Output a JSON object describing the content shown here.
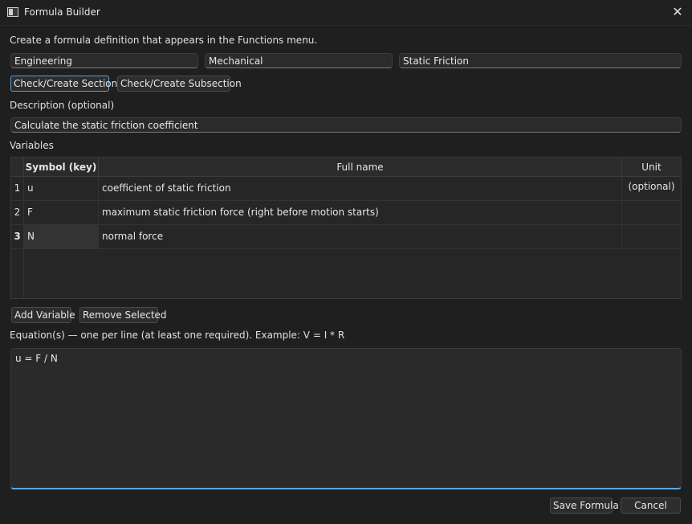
{
  "window": {
    "title": "Formula Builder",
    "close_glyph": "✕"
  },
  "intro": "Create a formula definition that appears in the Functions menu.",
  "category": {
    "section": "Engineering",
    "subsection": "Mechanical",
    "name": "Static Friction"
  },
  "buttons": {
    "check_section": "Check/Create Section",
    "check_subsection": "Check/Create Subsection",
    "add_variable": "Add Variable",
    "remove_selected": "Remove Selected",
    "save": "Save Formula",
    "cancel": "Cancel"
  },
  "description": {
    "label": "Description (optional)",
    "value": "Calculate the static friction coefficient"
  },
  "variables": {
    "label": "Variables",
    "columns": [
      "Symbol (key)",
      "Full name",
      "Unit (optional)"
    ],
    "rows": [
      {
        "num": "1",
        "symbol": "u",
        "full_name": "coefficient of static friction",
        "unit": ""
      },
      {
        "num": "2",
        "symbol": "F",
        "full_name": "maximum static friction force (right before motion starts)",
        "unit": ""
      },
      {
        "num": "3",
        "symbol": "N",
        "full_name": "normal force",
        "unit": ""
      }
    ]
  },
  "equations": {
    "label": "Equation(s) — one per line (at least one required). Example: V = I * R",
    "value": "u = F / N"
  },
  "colors": {
    "focus_accent": "#5aa0d6",
    "background": "#1f1f1f"
  }
}
